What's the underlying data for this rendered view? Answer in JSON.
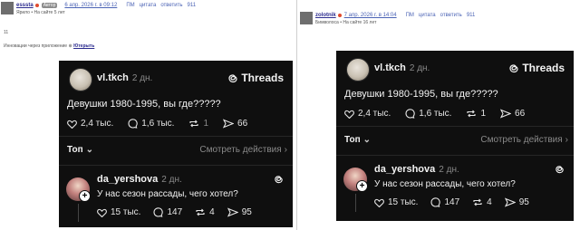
{
  "left_post": {
    "author": "esssta",
    "badge": "Автор",
    "date": "6 апр. 2026 г. в 09:12",
    "actions": [
      "ПМ",
      "цитата",
      "ответить",
      "911"
    ],
    "meta_line": "Ярило  •  На сайте 5 лет",
    "small_text": "11",
    "share_prefix": "Инновации через приложение",
    "share_link": "Ютерыть"
  },
  "right_post": {
    "author": "zolotnik",
    "date": "7 апр. 2026 г. в 14:04",
    "actions": [
      "ПМ",
      "цитата",
      "ответить",
      "911"
    ],
    "meta_line": "Бимволоса  •  На сайте 16 лет"
  },
  "threads": {
    "brand": "Threads",
    "post": {
      "username": "vl.tkch",
      "time": "2 дн.",
      "text": "Девушки 1980-1995, вы где?????",
      "likes": "2,4 тыс.",
      "comments": "1,6 тыс.",
      "reposts": "1",
      "shares": "66"
    },
    "sort_label": "Топ",
    "more_label": "Смотреть действия",
    "reply": {
      "username": "da_yershova",
      "time": "2 дн.",
      "text": "У нас сезон рассады, чего хотел?",
      "likes": "15 тыс.",
      "comments": "147",
      "reposts": "4",
      "shares": "95"
    }
  }
}
